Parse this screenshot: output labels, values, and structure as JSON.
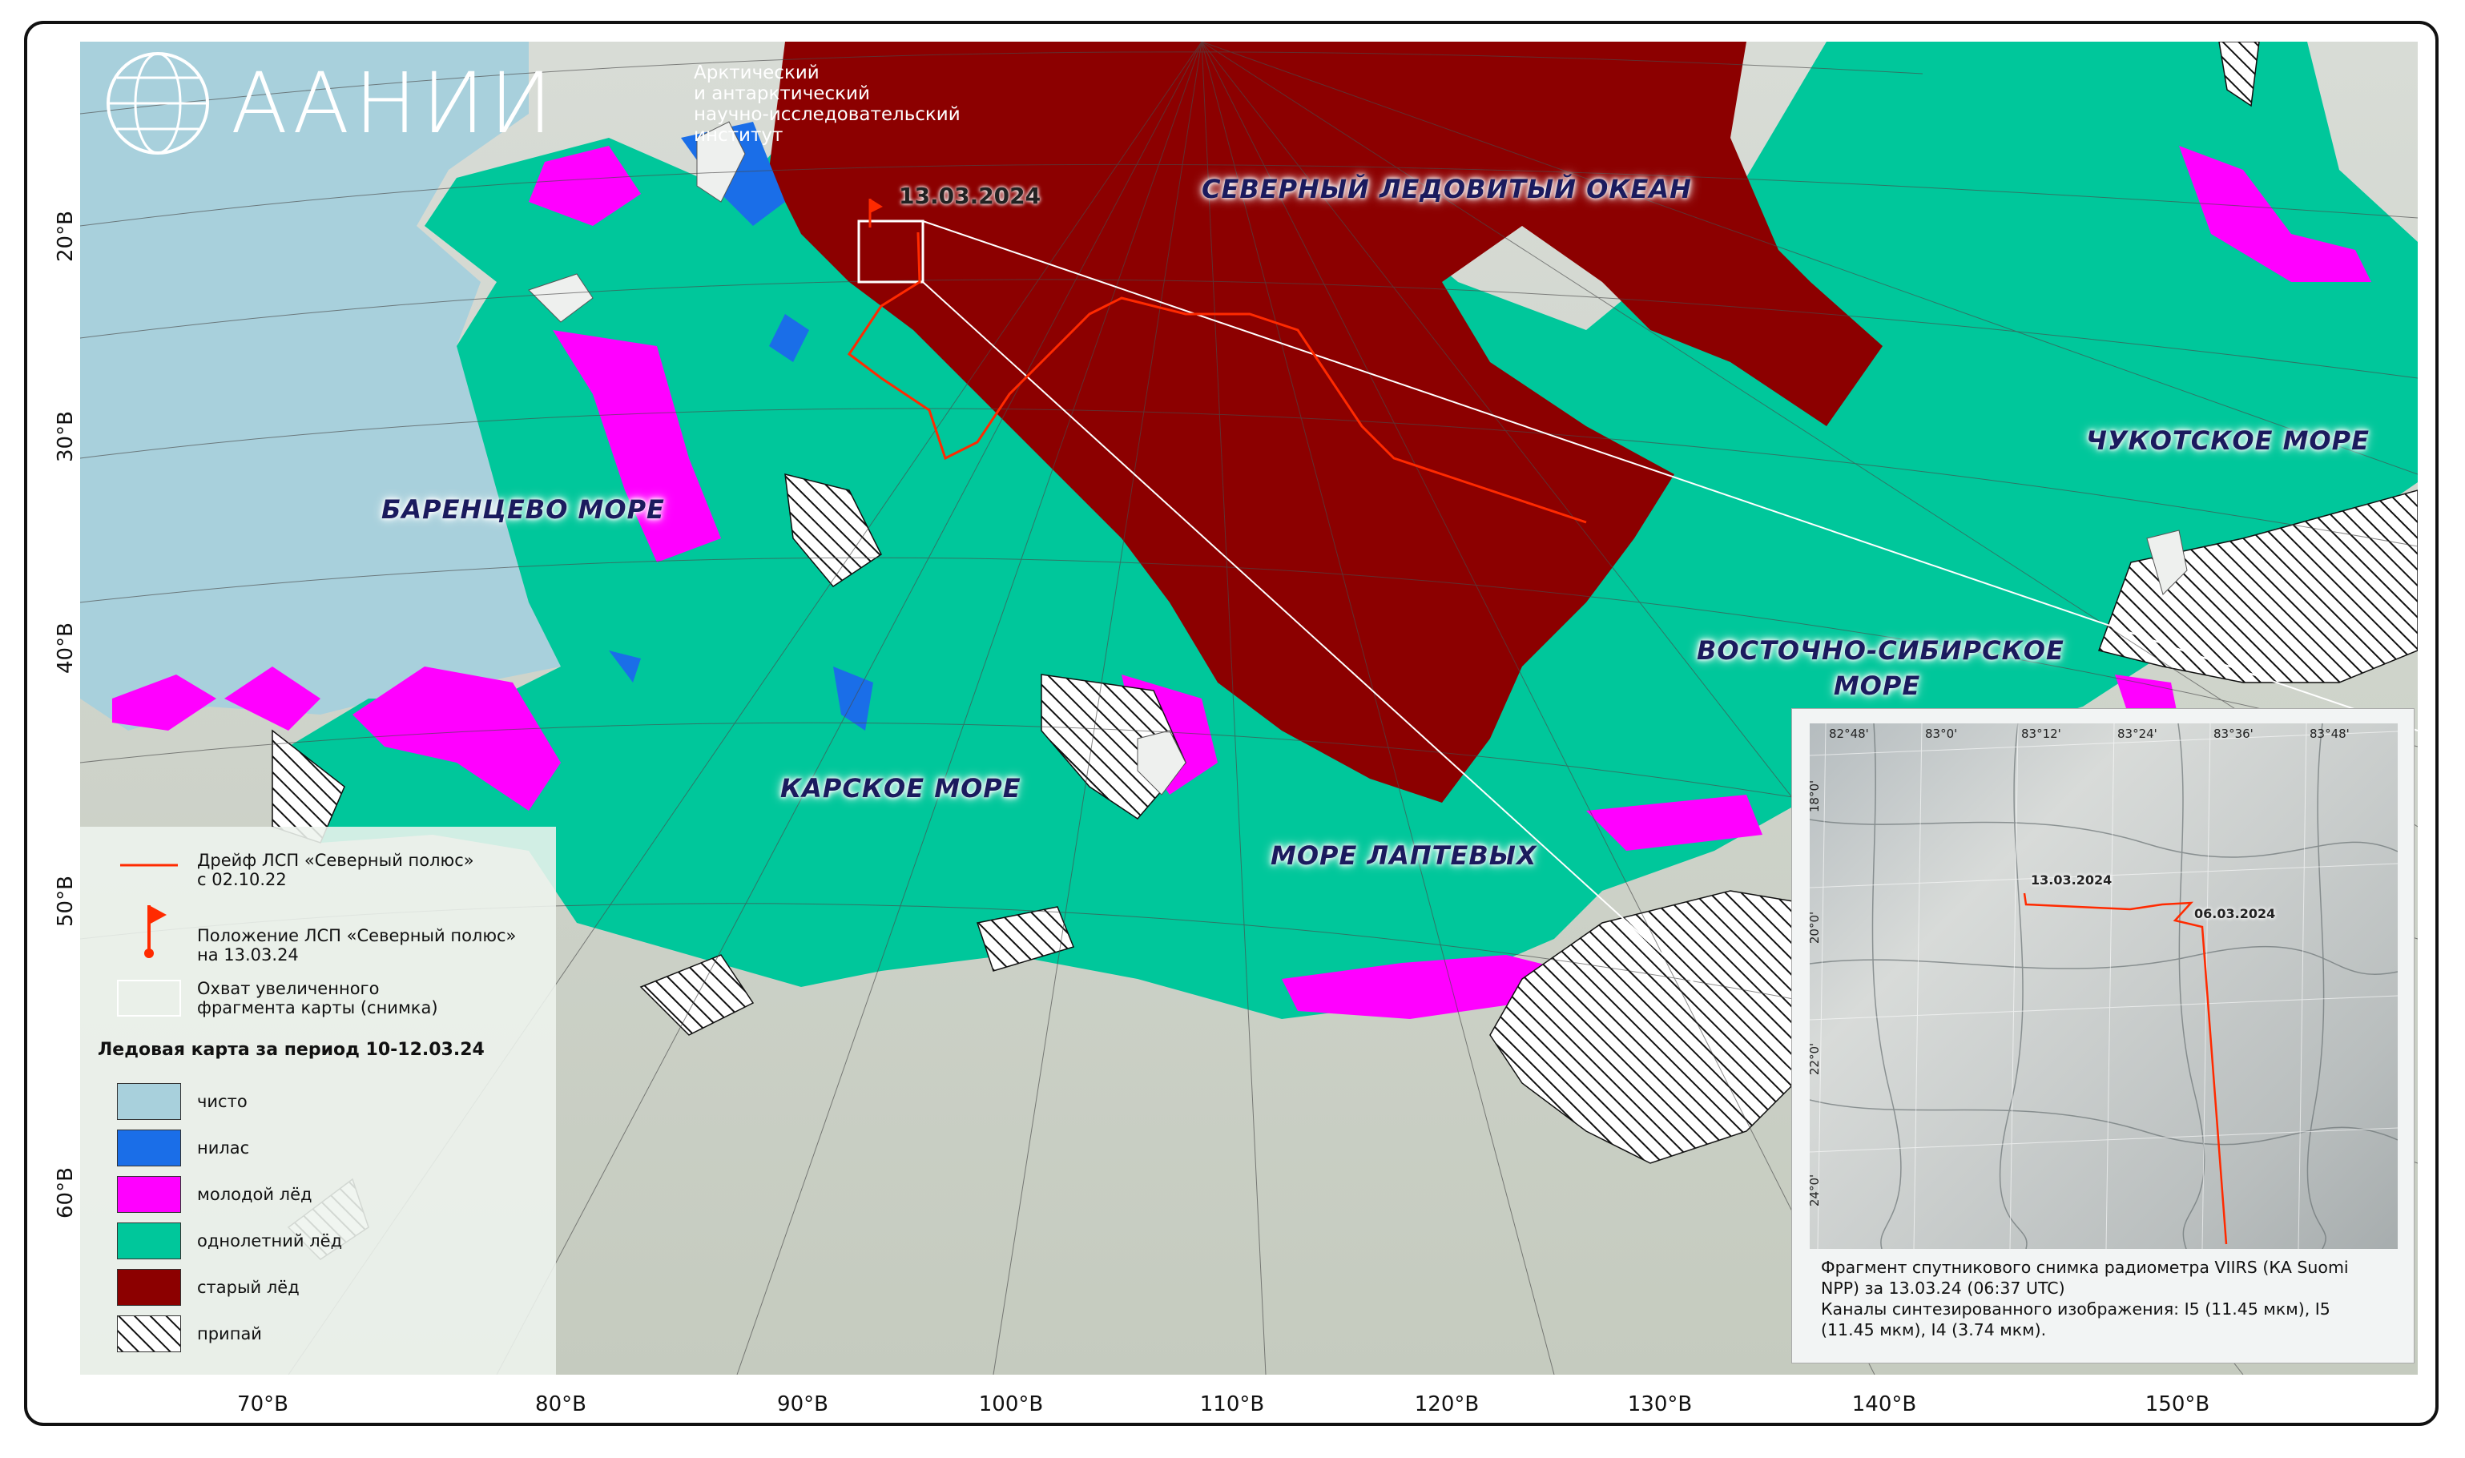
{
  "logo": {
    "name": "ААНИИ",
    "desc_lines": [
      "Арктический",
      "и антарктический",
      "научно-исследовательский",
      "институт"
    ]
  },
  "seas": {
    "arctic_ocean": "СЕВЕРНЫЙ ЛЕДОВИТЫЙ ОКЕАН",
    "barents": "БАРЕНЦЕВО МОРЕ",
    "kara": "КАРСКОЕ МОРЕ",
    "laptev": "МОРЕ ЛАПТЕВЫХ",
    "east_siberian_1": "ВОСТОЧНО-СИБИРСКОЕ",
    "east_siberian_2": "МОРЕ",
    "chukchi": "ЧУКОТСКОЕ МОРЕ"
  },
  "station_date": "13.03.2024",
  "axes": {
    "x_labels": [
      "70°В",
      "80°В",
      "90°В",
      "100°В",
      "110°В",
      "120°В",
      "130°В",
      "140°В",
      "150°В"
    ],
    "y_labels": [
      "20°В",
      "30°В",
      "40°В",
      "50°В",
      "60°В"
    ]
  },
  "legend": {
    "drift_line1": "Дрейф ЛСП «Северный полюс»",
    "drift_line2": "с 02.10.22",
    "position_line1": "Положение ЛСП «Северный полюс»",
    "position_line2": "на 13.03.24",
    "coverage_line1": "Охват увеличенного",
    "coverage_line2": "фрагмента карты (снимка)",
    "title": "Ледовая карта за период 10-12.03.24",
    "items": [
      {
        "label": "чисто",
        "color": "#a8d0dc"
      },
      {
        "label": "нилас",
        "color": "#1a6ee8"
      },
      {
        "label": "молодой лёд",
        "color": "#ff00ff"
      },
      {
        "label": "однолетний лёд",
        "color": "#00c79b"
      },
      {
        "label": "старый лёд",
        "color": "#8c0000"
      },
      {
        "label": "припай",
        "color": "hatch"
      }
    ]
  },
  "inset": {
    "top_ticks": [
      "82°48'",
      "83°0'",
      "83°12'",
      "83°24'",
      "83°36'",
      "83°48'"
    ],
    "left_ticks": [
      "18°0'",
      "20°0'",
      "22°0'",
      "24°0'"
    ],
    "date1": "13.03.2024",
    "date2": "06.03.2024",
    "caption_lines": [
      "Фрагмент спутникового снимка радиометра VIIRS (КА Suomi",
      "NPP) за 13.03.24 (06:37 UTC)",
      "Каналы синтезированного изображения: I5 (11.45 мкм), I5",
      "(11.45 мкм), I4 (3.74 мкм)."
    ]
  },
  "colors": {
    "clear": "#a8d0dc",
    "nilas": "#1a6ee8",
    "young_ice": "#ff00ff",
    "first_year_ice": "#00c79b",
    "old_ice": "#8c0000",
    "drift_line": "#ff2a00",
    "land": "#cfd4cc"
  }
}
